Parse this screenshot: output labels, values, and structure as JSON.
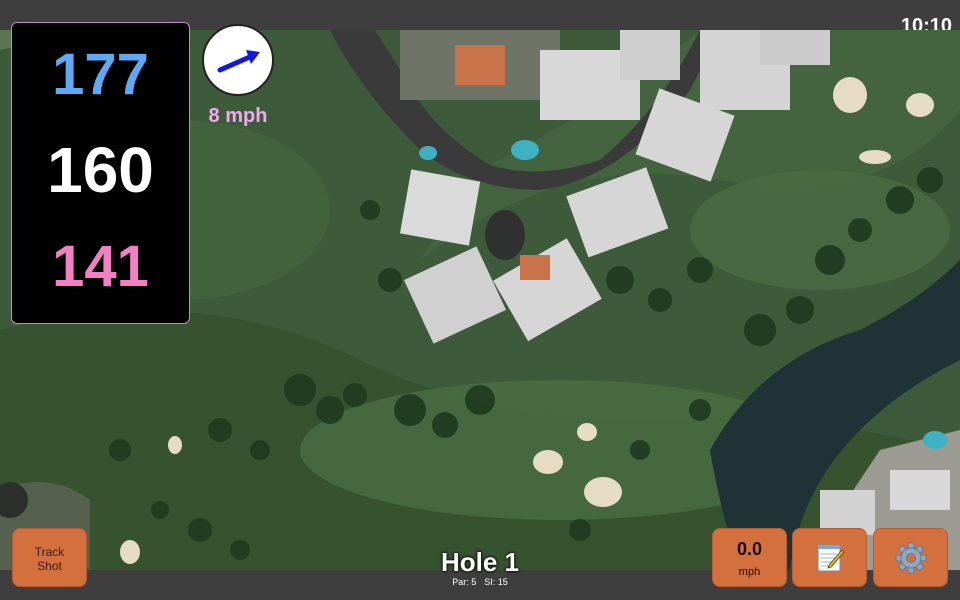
{
  "status": {
    "time": "10:10"
  },
  "distances": {
    "back": "177",
    "center": "160",
    "front": "141"
  },
  "wind": {
    "speed_label": "8 mph",
    "direction_icon": "wind-arrow-icon"
  },
  "hole": {
    "title": "Hole 1",
    "par_label": "Par: 5",
    "si_label": "SI: 15"
  },
  "buttons": {
    "track_shot_line1": "Track",
    "track_shot_line2": "Shot",
    "speed_value": "0.0",
    "speed_unit": "mph",
    "notes_icon": "notepad-icon",
    "settings_icon": "gear-icon"
  },
  "colors": {
    "back_distance": "#5fa8f2",
    "center_distance": "#ffffff",
    "front_distance": "#f281c4",
    "wind_label": "#f2a8ee",
    "button_bg": "#d4703e"
  }
}
